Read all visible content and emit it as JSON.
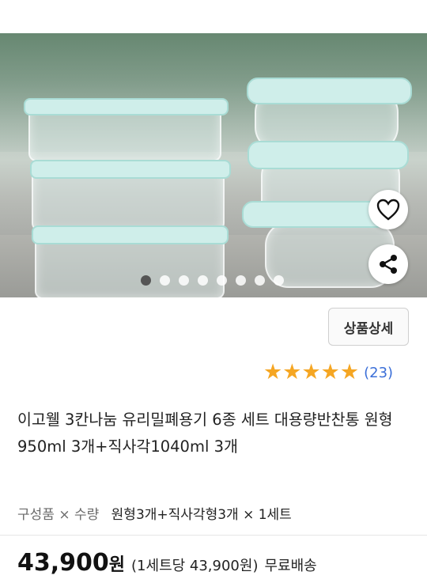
{
  "product": {
    "image_alt": "glass food containers",
    "detail_button": "상품상세",
    "rating": {
      "stars": 5,
      "count_text": "(23)"
    },
    "title": "이고웰 3칸나눔 유리밀폐용기 6종 세트 대용량반찬통 원형950ml 3개+직사각1040ml 3개",
    "option": {
      "label": "구성품 × 수량",
      "value": "원형3개+직사각형3개 × 1세트"
    },
    "price": {
      "amount": "43,900",
      "unit": "원",
      "unit_price": "(1세트당 43,900원)",
      "shipping": "무료배송"
    }
  },
  "carousel": {
    "total": 8,
    "active_index": 0
  },
  "icons": {
    "favorite": "heart-icon",
    "share": "share-icon",
    "star": "star-icon"
  },
  "colors": {
    "star": "#f5a623",
    "link": "#3b6fd8",
    "active_dot": "#555555"
  }
}
